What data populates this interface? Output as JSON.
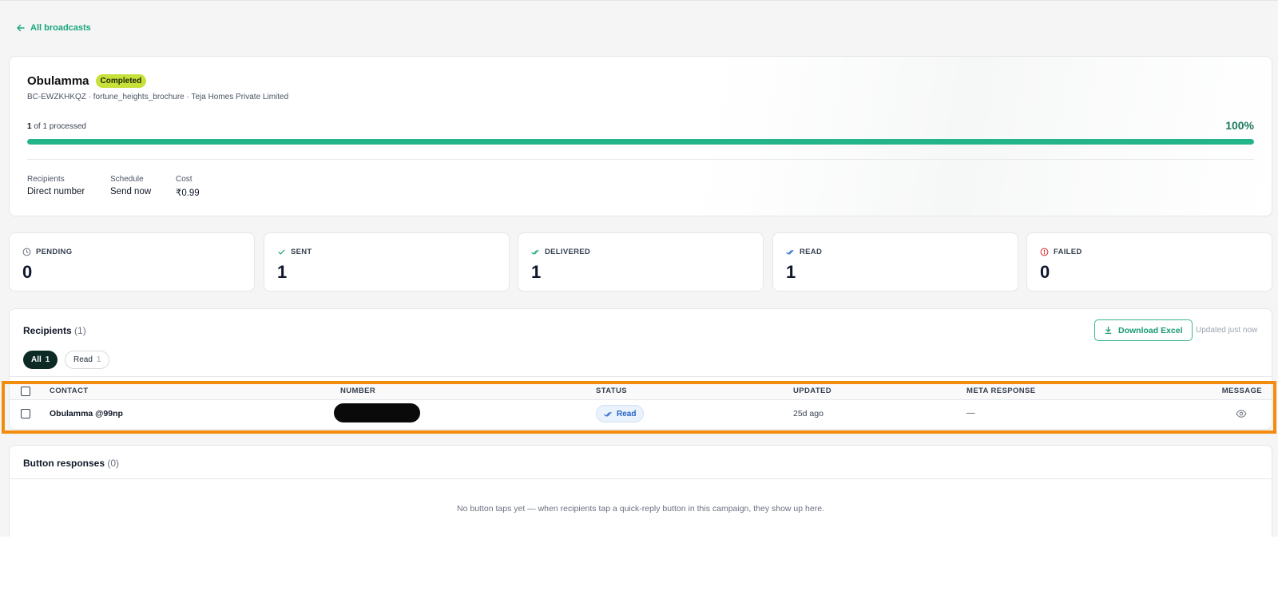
{
  "nav": {
    "back_label": "All broadcasts"
  },
  "broadcast": {
    "title": "Obulamma",
    "status_badge": "Completed",
    "subtitle": "BC-EWZKHKQZ · fortune_heights_brochure · Teja Homes Private Limited",
    "progress_done": "1",
    "progress_rest": "of 1 processed",
    "progress_percent_label": "100%",
    "progress_fraction": 1.0,
    "meta": [
      {
        "label": "Recipients",
        "value": "Direct number"
      },
      {
        "label": "Schedule",
        "value": "Send now"
      },
      {
        "label": "Cost",
        "value": "₹0.99"
      }
    ]
  },
  "stats": [
    {
      "label": "PENDING",
      "value": "0",
      "icon": "clock-icon",
      "color": "#6b7280"
    },
    {
      "label": "SENT",
      "value": "1",
      "icon": "check-icon",
      "color": "#1aa57f"
    },
    {
      "label": "DELIVERED",
      "value": "1",
      "icon": "double-check-icon",
      "color": "#1aa57f"
    },
    {
      "label": "READ",
      "value": "1",
      "icon": "double-check-icon",
      "color": "#2563c9"
    },
    {
      "label": "FAILED",
      "value": "0",
      "icon": "alert-circle-icon",
      "color": "#dc2626"
    }
  ],
  "recipients": {
    "title": "Recipients",
    "count": "(1)",
    "download_label": "Download Excel",
    "updated_text": "Updated just now",
    "filters": [
      {
        "label": "All",
        "count": "1",
        "active": true
      },
      {
        "label": "Read",
        "count": "1",
        "active": false
      }
    ],
    "columns": [
      "CONTACT",
      "NUMBER",
      "STATUS",
      "UPDATED",
      "META RESPONSE",
      "MESSAGE"
    ],
    "rows": [
      {
        "contact": "Obulamma @99np",
        "number_redacted": true,
        "status": "Read",
        "updated": "25d ago",
        "meta_response": "—"
      }
    ]
  },
  "button_responses": {
    "title": "Button responses",
    "count": "(0)",
    "empty_message": "No button taps yet — when recipients tap a quick-reply button in this campaign, they show up here."
  },
  "colors": {
    "accent": "#1aa57f",
    "progress": "#23b48a",
    "badge": "#c8e03a",
    "highlight": "#f28c0f"
  }
}
